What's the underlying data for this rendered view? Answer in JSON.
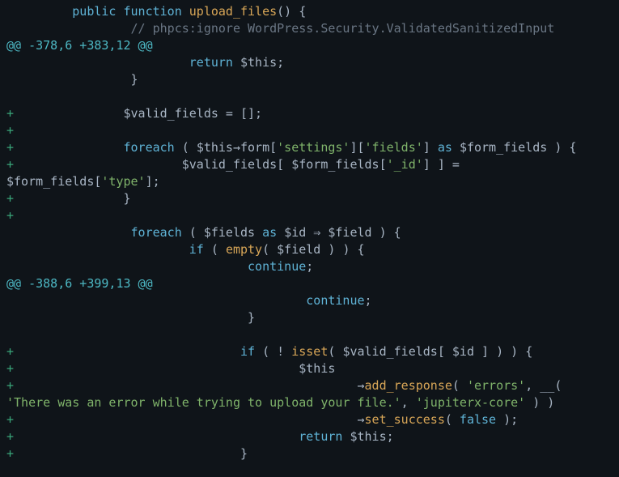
{
  "diff": {
    "lines": [
      {
        "type": "ctx",
        "indent": "        ",
        "html": "<span class='kw'>public</span> <span class='kw'>function</span> <span class='fn'>upload_files</span><span class='paren'>()</span> <span class='brace'>{</span>"
      },
      {
        "type": "ctx",
        "indent": "                ",
        "html": "<span class='comment'>// phpcs:ignore WordPress.Security.ValidatedSanitizedInput</span>"
      },
      {
        "type": "hunk",
        "text": "@@ -378,6 +383,12 @@"
      },
      {
        "type": "ctx",
        "indent": "                        ",
        "html": "<span class='kw'>return</span> <span class='var'>$this</span>;"
      },
      {
        "type": "ctx",
        "indent": "                ",
        "html": "<span class='brace'>}</span>"
      },
      {
        "type": "ctx",
        "indent": "",
        "html": ""
      },
      {
        "type": "add",
        "indent": "               ",
        "html": "<span class='var'>$valid_fields</span> = [];"
      },
      {
        "type": "add",
        "indent": "",
        "html": ""
      },
      {
        "type": "add",
        "indent": "               ",
        "html": "<span class='kw'>foreach</span> <span class='paren'>(</span> <span class='var'>$this</span><span class='arrow'>→</span>form[<span class='str'>'settings'</span>][<span class='str'>'fields'</span>] <span class='kw'>as</span> <span class='var'>$form_fields</span> <span class='paren'>)</span> <span class='brace'>{</span>"
      },
      {
        "type": "add",
        "indent": "                       ",
        "html": "<span class='var'>$valid_fields</span>[ <span class='var'>$form_fields</span>[<span class='str'>'_id'</span>] ] = <span class='var'>$form_fields</span>[<span class='str'>'type'</span>];"
      },
      {
        "type": "add",
        "indent": "               ",
        "html": "<span class='brace'>}</span>"
      },
      {
        "type": "add",
        "indent": "",
        "html": ""
      },
      {
        "type": "ctx",
        "indent": "                ",
        "html": "<span class='kw'>foreach</span> <span class='paren'>(</span> <span class='var'>$fields</span> <span class='kw'>as</span> <span class='var'>$id</span> ⇒ <span class='var'>$field</span> <span class='paren'>)</span> <span class='brace'>{</span>"
      },
      {
        "type": "ctx",
        "indent": "                        ",
        "html": "<span class='kw'>if</span> <span class='paren'>(</span> <span class='fn'>empty</span><span class='paren'>(</span> <span class='var'>$field</span> <span class='paren'>)</span> <span class='paren'>)</span> <span class='brace'>{</span>"
      },
      {
        "type": "ctx",
        "indent": "                                ",
        "html": "<span class='kw'>continue</span>;"
      },
      {
        "type": "hunk",
        "text": "@@ -388,6 +399,13 @@"
      },
      {
        "type": "ctx",
        "indent": "                                        ",
        "html": "<span class='kw'>continue</span>;"
      },
      {
        "type": "ctx",
        "indent": "                                ",
        "html": "<span class='brace'>}</span>"
      },
      {
        "type": "ctx",
        "indent": "",
        "html": ""
      },
      {
        "type": "add",
        "indent": "                               ",
        "html": "<span class='kw'>if</span> <span class='paren'>(</span> ! <span class='fn'>isset</span><span class='paren'>(</span> <span class='var'>$valid_fields</span>[ <span class='var'>$id</span> ] <span class='paren'>)</span> <span class='paren'>)</span> <span class='brace'>{</span>"
      },
      {
        "type": "add",
        "indent": "                                       ",
        "html": "<span class='var'>$this</span>"
      },
      {
        "type": "add",
        "indent": "                                               ",
        "html": "<span class='arrow'>→</span><span class='fn'>add_response</span><span class='paren'>(</span> <span class='str'>'errors'</span>, __<span class='paren'>(</span> <span class='str'>'There was an error while trying to upload your file.'</span>, <span class='str'>'jupiterx-core'</span> <span class='paren'>)</span> <span class='paren'>)</span>"
      },
      {
        "type": "add",
        "indent": "                                               ",
        "html": "<span class='arrow'>→</span><span class='fn'>set_success</span><span class='paren'>(</span> <span class='kw'>false</span> <span class='paren'>)</span>;"
      },
      {
        "type": "add",
        "indent": "                                       ",
        "html": "<span class='kw'>return</span> <span class='var'>$this</span>;"
      },
      {
        "type": "add",
        "indent": "                               ",
        "html": "<span class='brace'>}</span>"
      }
    ]
  }
}
